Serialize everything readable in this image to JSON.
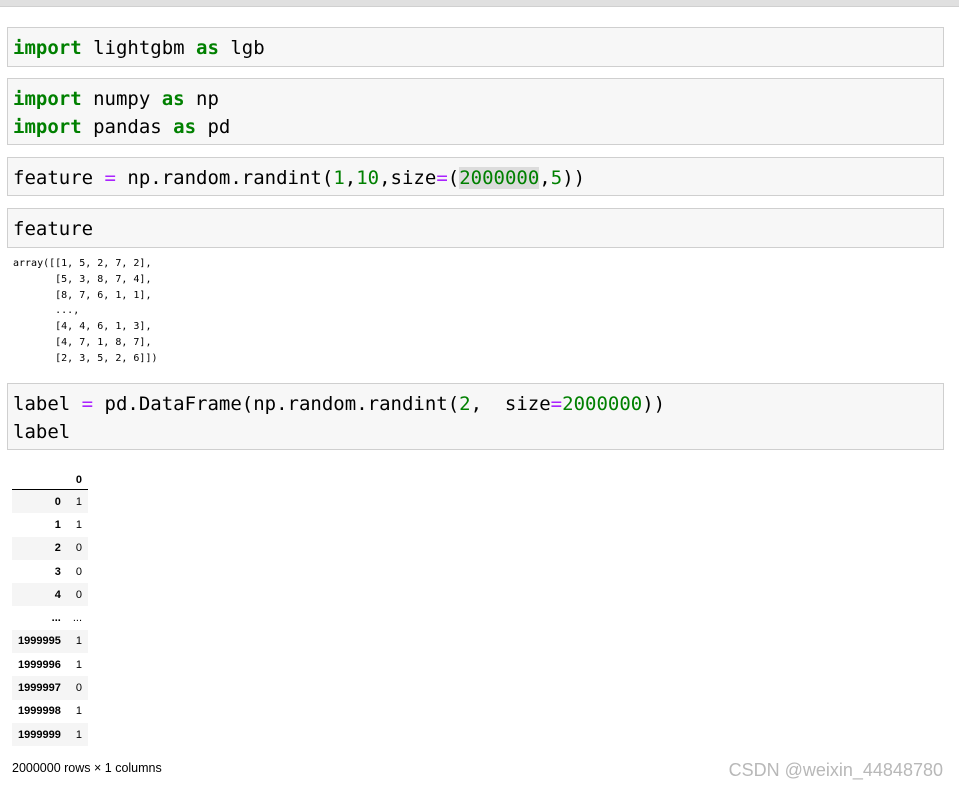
{
  "cells": [
    {
      "lines": [
        [
          {
            "t": "import",
            "c": "kw"
          },
          {
            "t": " lightgbm "
          },
          {
            "t": "as",
            "c": "kw"
          },
          {
            "t": " lgb"
          }
        ]
      ]
    },
    {
      "lines": [
        [
          {
            "t": "import",
            "c": "kw"
          },
          {
            "t": " numpy "
          },
          {
            "t": "as",
            "c": "kw"
          },
          {
            "t": " np"
          }
        ],
        [
          {
            "t": "import",
            "c": "kw"
          },
          {
            "t": " pandas "
          },
          {
            "t": "as",
            "c": "kw"
          },
          {
            "t": " pd"
          }
        ]
      ]
    },
    {
      "lines": [
        [
          {
            "t": "feature "
          },
          {
            "t": "=",
            "c": "op"
          },
          {
            "t": " np.random.randint("
          },
          {
            "t": "1",
            "c": "num"
          },
          {
            "t": ","
          },
          {
            "t": "10",
            "c": "num"
          },
          {
            "t": ",size"
          },
          {
            "t": "=",
            "c": "op"
          },
          {
            "t": "("
          },
          {
            "t": "2000000",
            "c": "num hl"
          },
          {
            "t": ","
          },
          {
            "t": "5",
            "c": "num"
          },
          {
            "t": "))"
          }
        ]
      ]
    },
    {
      "lines": [
        [
          {
            "t": "feature"
          }
        ]
      ]
    },
    {
      "lines": [
        [
          {
            "t": "label "
          },
          {
            "t": "=",
            "c": "op"
          },
          {
            "t": " pd.DataFrame(np.random.randint("
          },
          {
            "t": "2",
            "c": "num"
          },
          {
            "t": ",  size"
          },
          {
            "t": "=",
            "c": "op"
          },
          {
            "t": "2000000",
            "c": "num"
          },
          {
            "t": "))"
          }
        ],
        [
          {
            "t": "label"
          }
        ]
      ]
    }
  ],
  "array_output": "array([[1, 5, 2, 7, 2],\n       [5, 3, 8, 7, 4],\n       [8, 7, 6, 1, 1],\n       ...,\n       [4, 4, 6, 1, 3],\n       [4, 7, 1, 8, 7],\n       [2, 3, 5, 2, 6]])",
  "dataframe": {
    "columns": [
      "",
      "0"
    ],
    "rows": [
      [
        "0",
        "1"
      ],
      [
        "1",
        "1"
      ],
      [
        "2",
        "0"
      ],
      [
        "3",
        "0"
      ],
      [
        "4",
        "0"
      ],
      [
        "...",
        "..."
      ],
      [
        "1999995",
        "1"
      ],
      [
        "1999996",
        "1"
      ],
      [
        "1999997",
        "0"
      ],
      [
        "1999998",
        "1"
      ],
      [
        "1999999",
        "1"
      ]
    ],
    "footer": "2000000 rows × 1 columns"
  },
  "watermark": "CSDN @weixin_44848780"
}
